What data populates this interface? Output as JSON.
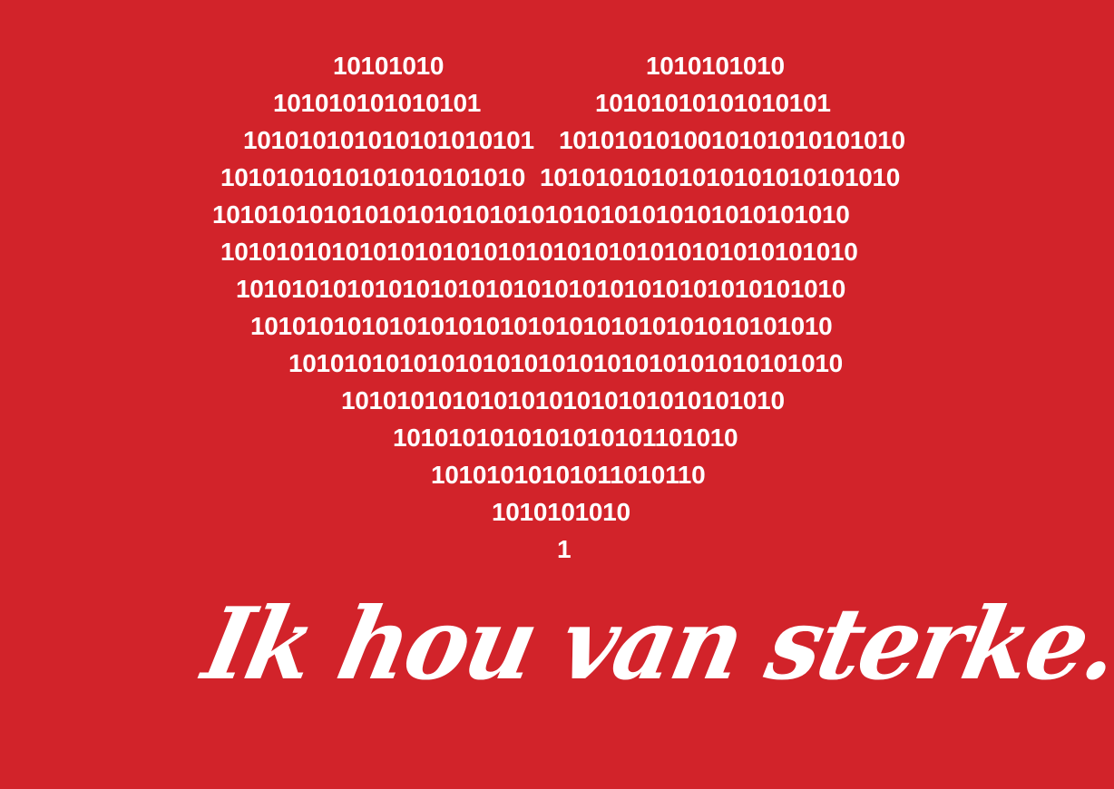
{
  "heart_rows": [
    {
      "left": "10101010",
      "right": "1010101010"
    },
    {
      "left": "101010101010101",
      "right": "10101010101010101"
    },
    {
      "left": "101010101010101010101",
      "right": "1010101010010101010101010"
    },
    {
      "left": "1010101010101010101010",
      "right": "10101010101010101010101010"
    },
    {
      "full": "1010101010101010101010101010101010101010101010"
    },
    {
      "full": "1010101010101010101010101010101010101010101010"
    },
    {
      "full": "10101010101010101010101010101010101010101010"
    },
    {
      "full": "101010101010101010101010101010101010101010"
    },
    {
      "full": "1010101010101010101010101010101010101010"
    },
    {
      "full": "10101010101010101010101010101010"
    },
    {
      "full": "1010101010101010101101010"
    },
    {
      "full": "10101010101011010110"
    },
    {
      "full": "1010101010"
    },
    {
      "full": "1"
    }
  ],
  "tagline": "Ik hou van sterke...."
}
